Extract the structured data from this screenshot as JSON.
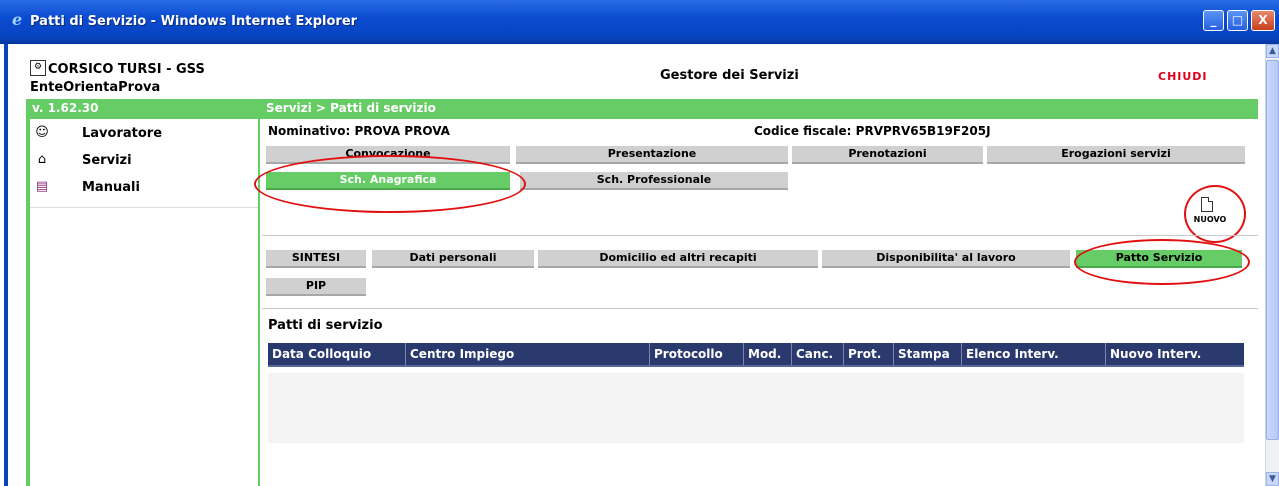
{
  "window": {
    "title": "Patti di Servizio - Windows Internet Explorer",
    "buttons": {
      "minimize": "_",
      "maximize": "□",
      "close": "X"
    }
  },
  "header": {
    "org_line1": "CORSICO TURSI - GSS",
    "org_line2": "EnteOrientaProva",
    "app_title": "Gestore dei Servizi",
    "close_label": "CHIUDI"
  },
  "statusbar": {
    "version": "v. 1.62.30",
    "breadcrumb": "Servizi > Patti di servizio"
  },
  "sidebar": {
    "items": [
      {
        "label": "Lavoratore",
        "icon": "worker-icon"
      },
      {
        "label": "Servizi",
        "icon": "house-icon"
      },
      {
        "label": "Manuali",
        "icon": "books-icon"
      }
    ]
  },
  "person": {
    "nominativo": "Nominativo: PROVA  PROVA",
    "codice_fiscale": "Codice fiscale: PRVPRV65B19F205J"
  },
  "main_tabs": {
    "row1": [
      "Convocazione",
      "Presentazione",
      "Prenotazioni",
      "Erogazioni servizi"
    ],
    "row2": [
      "Sch. Anagrafica",
      "Sch. Professionale"
    ],
    "active": "Sch. Anagrafica"
  },
  "new_button": {
    "label": "NUOVO"
  },
  "sub_tabs": {
    "row1": [
      "SINTESI",
      "Dati personali",
      "Domicilio ed altri recapiti",
      "Disponibilita' al lavoro",
      "Patto Servizio"
    ],
    "row2": [
      "PIP"
    ],
    "active": "Patto Servizio"
  },
  "patti": {
    "title": "Patti di servizio",
    "columns": [
      "Data Colloquio",
      "Centro Impiego",
      "Protocollo",
      "Mod.",
      "Canc.",
      "Prot.",
      "Stampa",
      "Elenco Interv.",
      "Nuovo Interv."
    ],
    "rows": []
  },
  "colors": {
    "accent_green": "#66cc66",
    "table_header": "#2a3a6e",
    "highlight_red": "#e01010",
    "titlebar_blue": "#0844c0"
  }
}
